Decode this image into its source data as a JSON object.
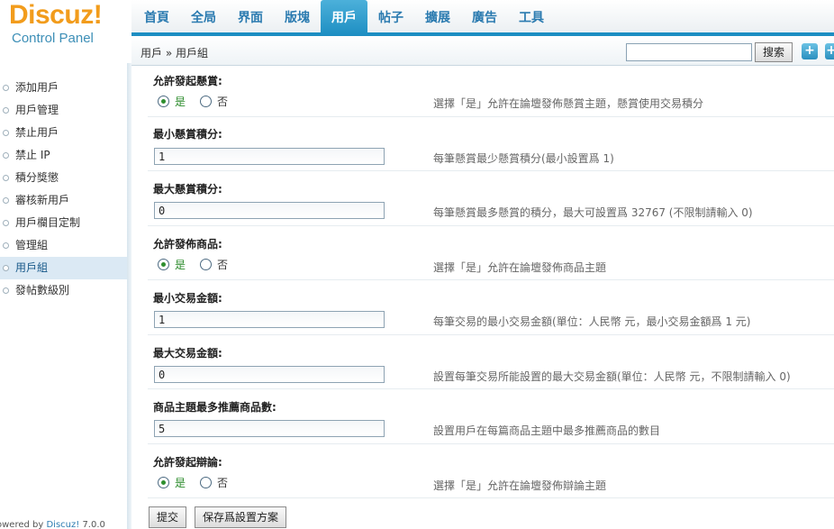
{
  "logo": {
    "brand": "Discuz",
    "bang": "!",
    "subtitle": "Control Panel"
  },
  "nav": {
    "tabs": [
      {
        "label": "首頁"
      },
      {
        "label": "全局"
      },
      {
        "label": "界面"
      },
      {
        "label": "版塊"
      },
      {
        "label": "用戶",
        "active": true
      },
      {
        "label": "帖子"
      },
      {
        "label": "擴展"
      },
      {
        "label": "廣告"
      },
      {
        "label": "工具"
      }
    ]
  },
  "breadcrumb": {
    "text": "用戶 » 用戶組"
  },
  "search": {
    "value": "",
    "button_label": "搜索",
    "add_label": "+"
  },
  "sidebar": {
    "items": [
      {
        "label": "添加用戶"
      },
      {
        "label": "用戶管理"
      },
      {
        "label": "禁止用戶"
      },
      {
        "label": "禁止 IP"
      },
      {
        "label": "積分獎懲"
      },
      {
        "label": "審核新用戶"
      },
      {
        "label": "用戶欄目定制"
      },
      {
        "label": "管理組"
      },
      {
        "label": "用戶組",
        "active": true
      },
      {
        "label": "發帖數級別"
      }
    ],
    "powered": {
      "prefix": "owered by ",
      "brand": "Discuz!",
      "version": " 7.0.0"
    }
  },
  "settings": {
    "reward_allow": {
      "title": "允許發起懸賞:",
      "yes": "是",
      "no": "否",
      "selected": "yes",
      "desc": "選擇「是」允許在論壇發佈懸賞主題，懸賞使用交易積分"
    },
    "reward_min": {
      "title": "最小懸賞積分:",
      "value": "1",
      "desc": "每筆懸賞最少懸賞積分(最小設置爲 1)"
    },
    "reward_max": {
      "title": "最大懸賞積分:",
      "value": "0",
      "desc": "每筆懸賞最多懸賞的積分，最大可設置爲 32767 (不限制請輸入 0)"
    },
    "trade_allow": {
      "title": "允許發佈商品:",
      "yes": "是",
      "no": "否",
      "selected": "yes",
      "desc": "選擇「是」允許在論壇發佈商品主題"
    },
    "trade_min": {
      "title": "最小交易金額:",
      "value": "1",
      "desc": "每筆交易的最小交易金額(單位：人民幣 元，最小交易金額爲 1 元)"
    },
    "trade_max": {
      "title": "最大交易金額:",
      "value": "0",
      "desc": "設置每筆交易所能設置的最大交易金額(單位：人民幣 元，不限制請輸入 0)"
    },
    "trade_stick": {
      "title": "商品主題最多推薦商品數:",
      "value": "5",
      "desc": "設置用戶在每篇商品主題中最多推薦商品的數目"
    },
    "debate_allow": {
      "title": "允許發起辯論:",
      "yes": "是",
      "no": "否",
      "selected": "yes",
      "desc": "選擇「是」允許在論壇發佈辯論主題"
    }
  },
  "actions": {
    "submit": "提交",
    "save_scheme": "保存爲設置方案"
  },
  "colors": {
    "accent": "#1d8ec2",
    "logo": "#f29c1c",
    "nav_text": "#2b7bb0"
  }
}
